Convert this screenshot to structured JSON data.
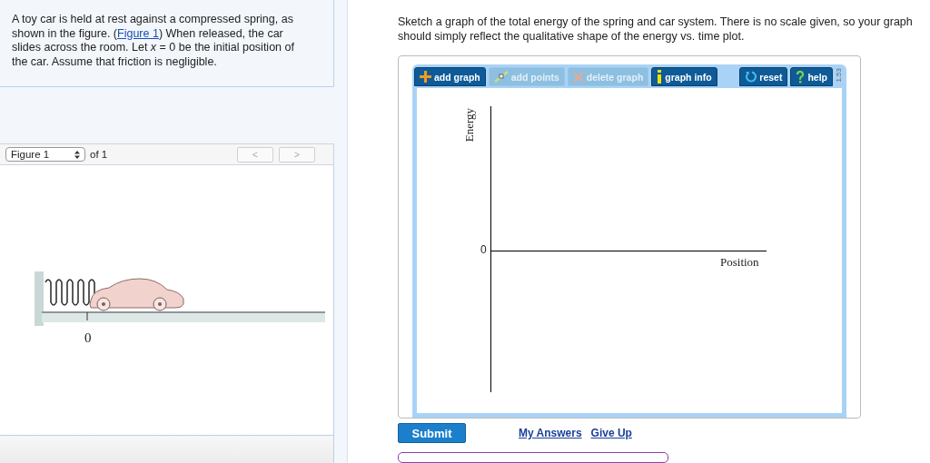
{
  "problem": {
    "text": "A toy car is held at rest against a compressed spring, as shown in the figure. (",
    "link": "Figure 1",
    "text_after": ") When released, the car slides across the room. Let *x* = 0 be the initial position of the car. Assume that friction is negligible."
  },
  "figure_nav": {
    "select": "Figure 1",
    "of_label": "of 1",
    "prev": "<",
    "next": ">"
  },
  "figure": {
    "axis_label": "0"
  },
  "question": "Sketch a graph of the total energy of the spring and car system. There is no scale given, so your graph should simply reflect the qualitative shape of the energy vs. time plot.",
  "toolbar": {
    "tools": [
      {
        "kind": "add",
        "label": "add graph",
        "disabled": false
      },
      {
        "kind": "points",
        "label": "add points",
        "disabled": true
      },
      {
        "kind": "delete",
        "label": "delete graph",
        "disabled": true
      },
      {
        "kind": "info",
        "label": "graph info",
        "disabled": false
      }
    ],
    "actions": [
      {
        "kind": "reset",
        "label": "reset"
      },
      {
        "kind": "help",
        "label": "help"
      }
    ],
    "version": "1.53"
  },
  "graph": {
    "ylabel": "Energy",
    "xlabel": "Position",
    "origin": "0"
  },
  "submit": "Submit",
  "links": [
    "My Answers",
    "Give Up"
  ]
}
